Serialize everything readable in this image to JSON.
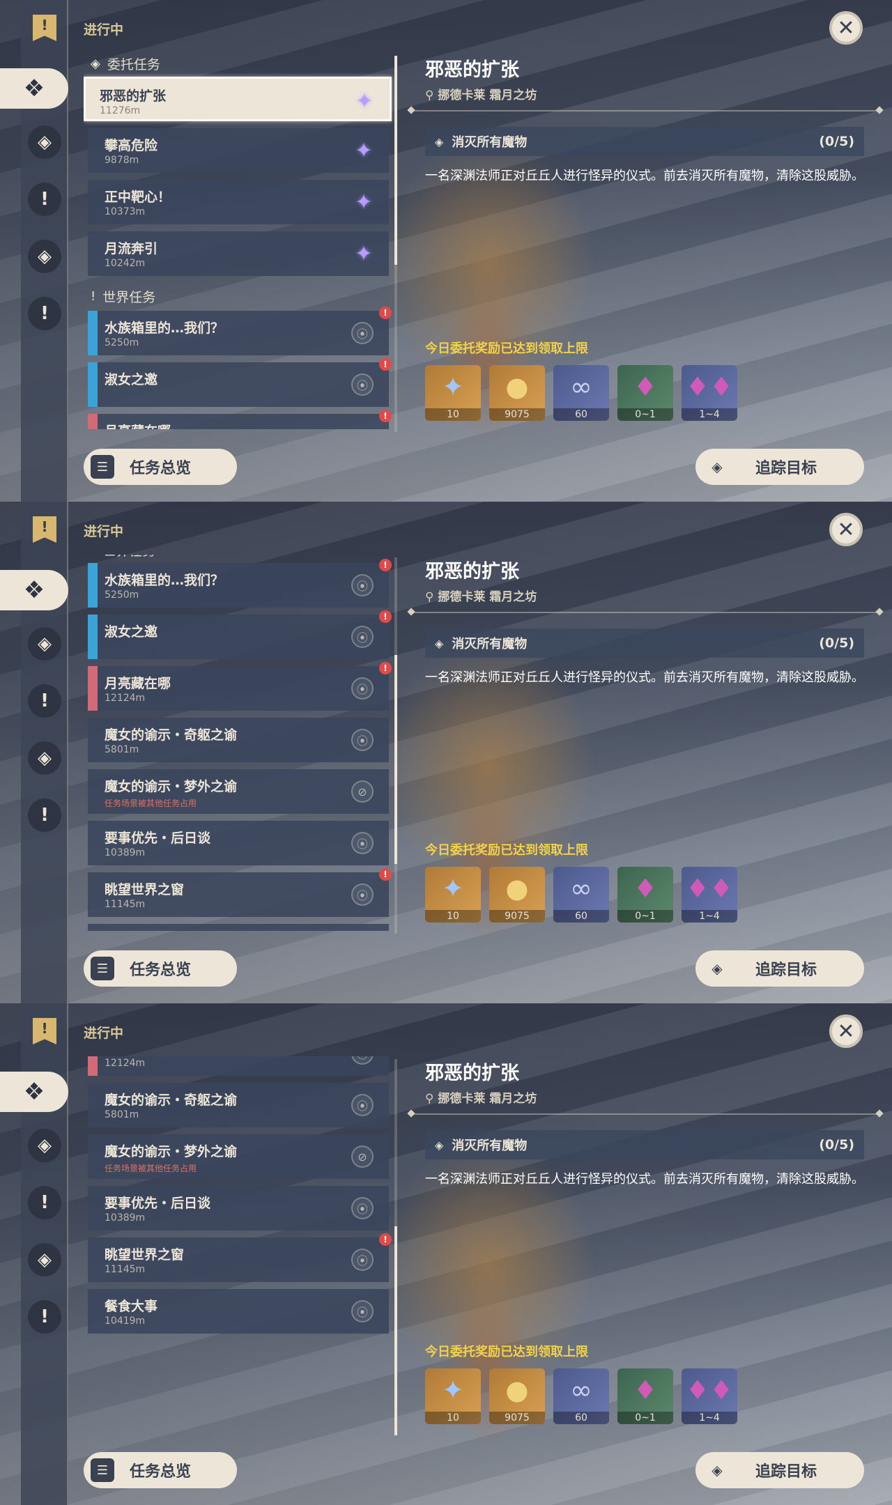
{
  "status_label": "进行中",
  "sections": {
    "commission": "委托任务",
    "world": "世界任务"
  },
  "quests": [
    {
      "name": "邪恶的扩张",
      "dist": "11276m"
    },
    {
      "name": "攀高危险",
      "dist": "9878m"
    },
    {
      "name": "正中靶心！",
      "dist": "10373m"
    },
    {
      "name": "月流奔引",
      "dist": "10242m"
    },
    {
      "name": "水族箱里的…我们？",
      "dist": "5250m"
    },
    {
      "name": "淑女之邀",
      "dist": ""
    },
    {
      "name": "月亮藏在哪",
      "dist": "12124m"
    },
    {
      "name": "魔女的谕示・奇躯之谕",
      "dist": "5801m"
    },
    {
      "name": "魔女的谕示・梦外之谕",
      "note": "任务场景被其他任务占用"
    },
    {
      "name": "要事优先・后日谈",
      "dist": "10389m"
    },
    {
      "name": "眺望世界之窗",
      "dist": "11145m"
    },
    {
      "name": "餐食大事",
      "dist": "10419m"
    }
  ],
  "detail": {
    "title": "邪恶的扩张",
    "location": "挪德卡莱 霜月之坊",
    "objective": "消灭所有魔物",
    "objective_count": "(0/5)",
    "description": "一名深渊法师正对丘丘人进行怪异的仪式。前去消灭所有魔物，清除这股威胁。",
    "reward_notice": "今日委托奖励已达到领取上限",
    "rewards": [
      {
        "icon": "adventure-exp-icon",
        "qty": "10"
      },
      {
        "icon": "mora-icon",
        "qty": "9075"
      },
      {
        "icon": "friendship-exp-icon",
        "qty": "60"
      },
      {
        "icon": "crystal-small-icon",
        "qty": "0~1"
      },
      {
        "icon": "crystal-large-icon",
        "qty": "1~4"
      }
    ]
  },
  "buttons": {
    "overview": "任务总览",
    "track": "追踪目标"
  },
  "colors": {
    "accent_gold": "#f2d24a",
    "panel_cream": "#ece5d8",
    "commission_stripe": "#3aa4d8",
    "warning_stripe": "#d26a77",
    "badge_red": "#e24a4a"
  }
}
